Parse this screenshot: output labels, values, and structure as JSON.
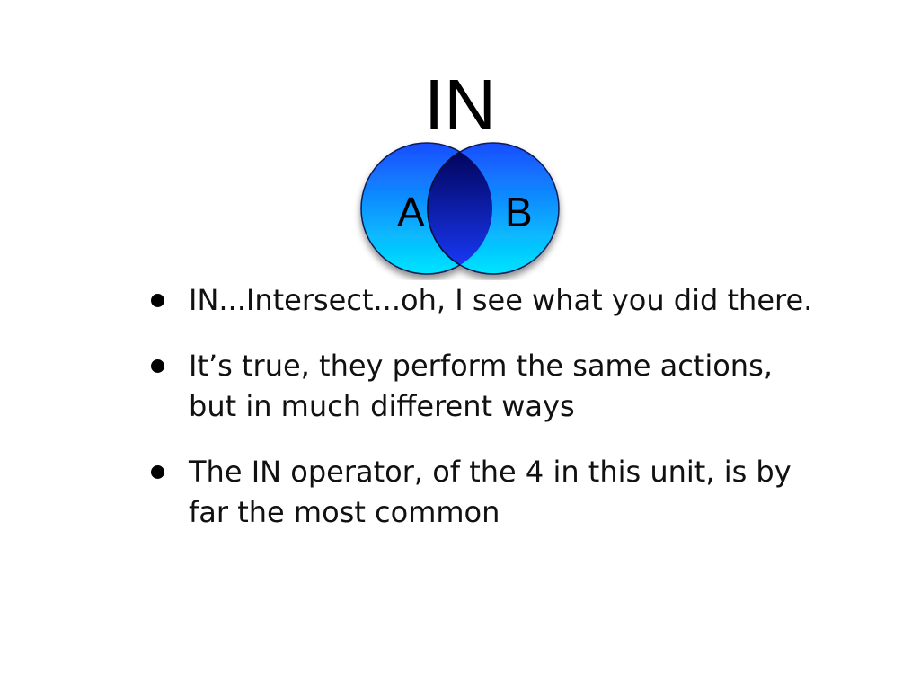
{
  "slide": {
    "title": "IN",
    "venn": {
      "circle_a_label": "A",
      "circle_b_label": "B",
      "colors": {
        "circle_top": "#1a4dff",
        "circle_bottom": "#00e5ff",
        "intersection_top": "#000050",
        "intersection_bottom": "#1a3cff"
      }
    },
    "bullets": [
      "IN...Intersect...oh, I see what you did there.",
      "It’s true, they perform the same actions, but in much different ways",
      "The IN operator, of the 4 in this unit, is by far the most common"
    ]
  }
}
